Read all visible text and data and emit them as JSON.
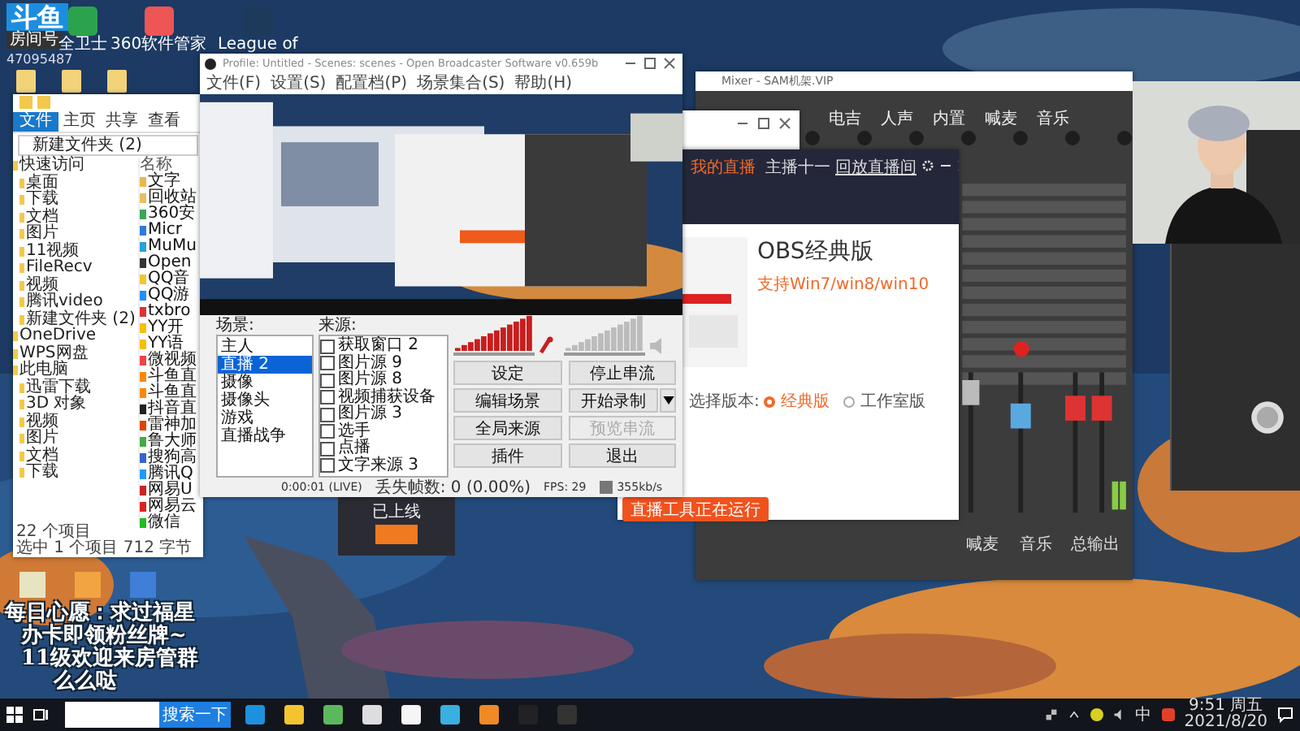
{
  "desktop": {
    "logo": "斗鱼",
    "room_label": "房间号",
    "room_number": "47095487",
    "icons": [
      {
        "label": "全卫士"
      },
      {
        "label": "360软件管家"
      },
      {
        "label": "League of"
      }
    ]
  },
  "explorer": {
    "file_button": "文件",
    "tabs": [
      "主页",
      "共享",
      "查看"
    ],
    "address": "新建文件夹 (2)",
    "nav": [
      {
        "label": "快速访问",
        "children": [
          {
            "label": "桌面"
          },
          {
            "label": "下载"
          },
          {
            "label": "文档"
          },
          {
            "label": "图片"
          },
          {
            "label": "11视频"
          },
          {
            "label": "FileRecv"
          },
          {
            "label": "视频"
          },
          {
            "label": "腾讯video"
          },
          {
            "label": "新建文件夹 (2)"
          }
        ]
      },
      {
        "label": "OneDrive"
      },
      {
        "label": "WPS网盘"
      },
      {
        "label": "此电脑",
        "children": [
          {
            "label": "迅雷下载"
          },
          {
            "label": "3D 对象"
          },
          {
            "label": "视频"
          },
          {
            "label": "图片"
          },
          {
            "label": "文档"
          },
          {
            "label": "下载"
          }
        ]
      }
    ],
    "column": "名称",
    "files": [
      "文字",
      "回收站",
      "360安",
      "Micr",
      "MuMu",
      "Open",
      "QQ音",
      "QQ游",
      "txbro",
      "YY开",
      "YY语",
      "微视频",
      "斗鱼直",
      "斗鱼直",
      "抖音直",
      "雷神加",
      "鲁大师",
      "搜狗高",
      "腾讯Q",
      "网易U",
      "网易云",
      "微信"
    ],
    "status": [
      "22 个项目",
      "选中 1 个项目 712 字节"
    ]
  },
  "obs": {
    "title": "Profile: Untitled - Scenes: scenes - Open Broadcaster Software v0.659b",
    "menu": [
      "文件(F)",
      "设置(S)",
      "配置档(P)",
      "场景集合(S)",
      "帮助(H)"
    ],
    "preview": {
      "kind": "picture"
    },
    "scenes_label": "场景:",
    "scenes": [
      {
        "label": "主人",
        "selected": false
      },
      {
        "label": "直播 2",
        "selected": true
      },
      {
        "label": "摄像",
        "selected": false
      },
      {
        "label": "摄像头",
        "selected": false
      },
      {
        "label": "游戏",
        "selected": false
      },
      {
        "label": "直播战争",
        "selected": false
      }
    ],
    "sources_label": "来源:",
    "sources": [
      {
        "label": "获取窗口 2",
        "checked": false
      },
      {
        "label": "图片源 9",
        "checked": false
      },
      {
        "label": "图片源 8",
        "checked": false
      },
      {
        "label": "视频捕获设备",
        "checked": false
      },
      {
        "label": "图片源 3",
        "checked": false
      },
      {
        "label": "选手",
        "checked": false
      },
      {
        "label": "点播",
        "checked": false
      },
      {
        "label": "文字来源 3",
        "checked": false
      }
    ],
    "audio": [
      {
        "kind": "mic",
        "level": 1,
        "muted": false
      },
      {
        "kind": "desktop",
        "level": 1,
        "muted": true
      }
    ],
    "buttons": [
      {
        "label": "设定",
        "disabled": false,
        "dropdown": false
      },
      {
        "label": "停止串流",
        "disabled": false,
        "dropdown": false
      },
      {
        "label": "编辑场景",
        "disabled": false,
        "dropdown": false
      },
      {
        "label": "开始录制",
        "disabled": false,
        "dropdown": true
      },
      {
        "label": "全局来源",
        "disabled": false,
        "dropdown": false
      },
      {
        "label": "预览串流",
        "disabled": true,
        "dropdown": false
      },
      {
        "label": "插件",
        "disabled": false,
        "dropdown": false
      },
      {
        "label": "退出",
        "disabled": false,
        "dropdown": false
      }
    ],
    "status": {
      "time": "0:00:01 (LIVE)",
      "dropped": "丢失帧数: 0 (0.00%)",
      "fps": "FPS: 29",
      "bitrate": "355kb/s"
    }
  },
  "popup": {
    "label": "已上线"
  },
  "installer": {
    "my_live": "我的直播",
    "user": "主播十一",
    "replay": "回放直播间",
    "title": "OBS经典版",
    "subtitle": "支持Win7/win8/win10",
    "version_label": "选择版本:",
    "versions": [
      {
        "label": "经典版",
        "selected": true
      },
      {
        "label": "工作室版",
        "selected": false
      }
    ],
    "run_button": "直播工具正在运行"
  },
  "mixer": {
    "title": "Mixer - SAM机架.VIP",
    "channels": [
      "电吉",
      "人声",
      "内置",
      "喊麦",
      "音乐"
    ],
    "outputs": [
      "喊麦",
      "音乐",
      "总输出"
    ]
  },
  "webcam": {
    "kind": "picture"
  },
  "overlay": [
    "每日心愿：求过福星",
    "办卡即领粉丝牌~",
    "11级欢迎来房管群",
    "么么哒"
  ],
  "taskbar": {
    "search_button": "搜索一下",
    "ime": "中",
    "time": "9:51 周五",
    "date": "2021/8/20"
  }
}
